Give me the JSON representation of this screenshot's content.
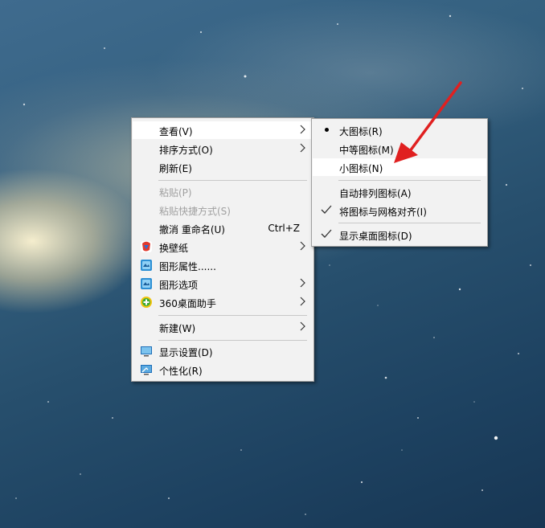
{
  "context_menu": {
    "items": [
      {
        "label": "查看(V)",
        "state": "highlighted",
        "submenu": true
      },
      {
        "label": "排序方式(O)",
        "submenu": true
      },
      {
        "label": "刷新(E)"
      },
      {
        "label": "粘贴(P)",
        "state": "disabled"
      },
      {
        "label": "粘贴快捷方式(S)",
        "state": "disabled"
      },
      {
        "label": "撤消 重命名(U)",
        "shortcut": "Ctrl+Z"
      },
      {
        "label": "换壁纸",
        "icon": "wallpaper-app-icon",
        "submenu": true
      },
      {
        "label": "图形属性......",
        "icon": "graphics-properties-icon"
      },
      {
        "label": "图形选项",
        "icon": "graphics-options-icon",
        "submenu": true
      },
      {
        "label": "360桌面助手",
        "icon": "360-desktop-assistant-icon",
        "submenu": true
      },
      {
        "label": "新建(W)",
        "submenu": true
      },
      {
        "label": "显示设置(D)",
        "icon": "display-settings-icon"
      },
      {
        "label": "个性化(R)",
        "icon": "personalize-icon"
      }
    ]
  },
  "view_submenu": {
    "items": [
      {
        "label": "大图标(R)",
        "mark": "bullet"
      },
      {
        "label": "中等图标(M)"
      },
      {
        "label": "小图标(N)",
        "state": "highlighted"
      },
      {
        "label": "自动排列图标(A)"
      },
      {
        "label": "将图标与网格对齐(I)",
        "mark": "check"
      },
      {
        "label": "显示桌面图标(D)",
        "mark": "check"
      }
    ]
  },
  "colors": {
    "menu_background": "#f2f2f2",
    "highlight": "#ffffff",
    "disabled_text": "#a0a0a0",
    "annotation_arrow": "#e02020"
  }
}
